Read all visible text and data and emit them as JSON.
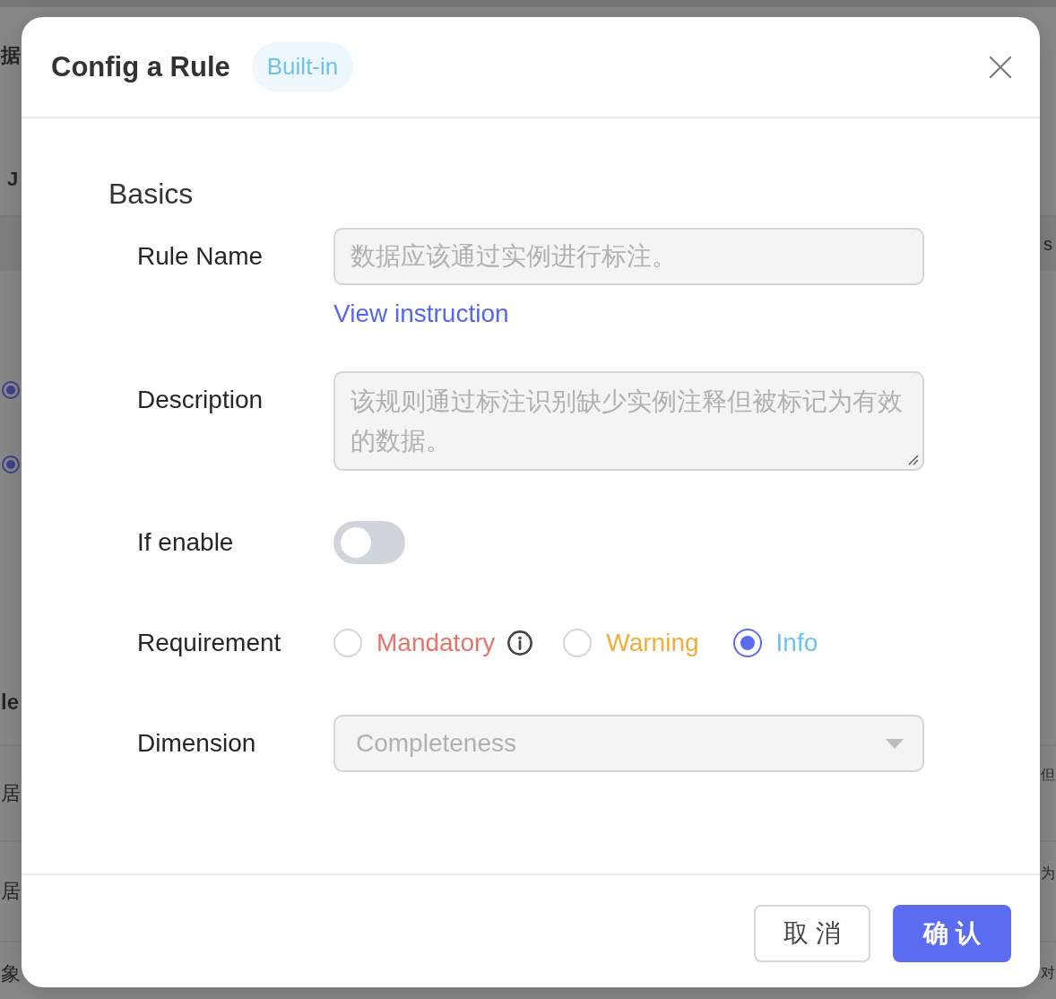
{
  "background_page": {
    "rows": [
      {
        "kind": "text",
        "left": "据"
      },
      {
        "kind": "text",
        "left": "J"
      },
      {
        "kind": "text",
        "right": "s"
      },
      {
        "kind": "radio",
        "selected": true
      },
      {
        "kind": "radio",
        "selected": true
      },
      {
        "kind": "text",
        "left": "le"
      },
      {
        "kind": "text",
        "left": "居",
        "right": "但"
      },
      {
        "kind": "text",
        "left": "居",
        "right": "为"
      },
      {
        "kind": "text",
        "left": "象",
        "right": "对"
      }
    ]
  },
  "dialog": {
    "title": "Config a Rule",
    "badge": "Built-in",
    "section": "Basics",
    "fields": [
      {
        "kind": "text",
        "label": "Rule Name",
        "value": "数据应该通过实例进行标注。",
        "disabled": true,
        "link": "View instruction"
      },
      {
        "kind": "textarea",
        "label": "Description",
        "value": "该规则通过标注识别缺少实例注释但被标记为有效的数据。",
        "disabled": true
      },
      {
        "kind": "switch",
        "label": "If enable",
        "on": false
      },
      {
        "kind": "radio",
        "label": "Requirement",
        "options": [
          {
            "label": "Mandatory",
            "color": "#e8736a",
            "selected": false,
            "info": true
          },
          {
            "label": "Warning",
            "color": "#f0ad3c",
            "selected": false,
            "info": false
          },
          {
            "label": "Info",
            "color": "#6cc3ea",
            "selected": true,
            "info": false
          }
        ]
      },
      {
        "kind": "select",
        "label": "Dimension",
        "value": "Completeness",
        "disabled": true
      }
    ]
  },
  "buttons": [
    {
      "kind": "default",
      "label": "取 消"
    },
    {
      "kind": "primary",
      "label": "确 认"
    }
  ]
}
